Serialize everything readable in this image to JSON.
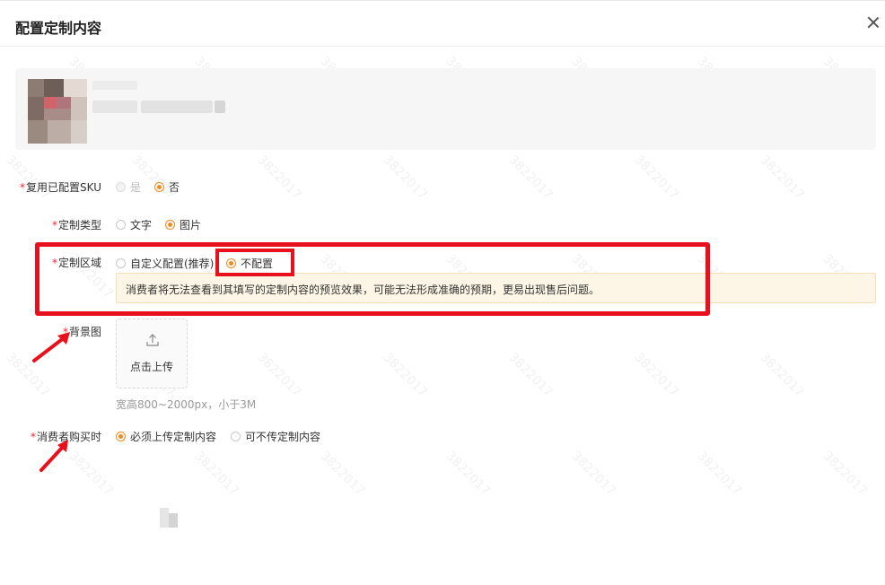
{
  "dialog": {
    "title": "配置定制内容"
  },
  "form": {
    "reuse_sku": {
      "label": "复用已配置SKU",
      "options": [
        "是",
        "否"
      ],
      "selected": "否"
    },
    "custom_type": {
      "label": "定制类型",
      "options": [
        "文字",
        "图片"
      ],
      "selected": "图片"
    },
    "custom_area": {
      "label": "定制区域",
      "options": [
        "自定义配置(推荐)",
        "不配置"
      ],
      "selected": "不配置",
      "warning": "消费者将无法查看到其填写的定制内容的预览效果，可能无法形成准确的预期，更易出现售后问题。"
    },
    "background": {
      "label": "背景图",
      "upload_text": "点击上传",
      "hint": "宽高800~2000px，小于3M"
    },
    "purchase": {
      "label": "消费者购买时",
      "options": [
        "必须上传定制内容",
        "可不传定制内容"
      ],
      "selected": "必须上传定制内容"
    }
  },
  "required_mark": "*",
  "watermark_text": "3822017",
  "colors": {
    "accent": "#f08a22",
    "required": "#f5222d",
    "annotation_red": "#e8101c",
    "warning_bg": "#fdf6e6"
  }
}
